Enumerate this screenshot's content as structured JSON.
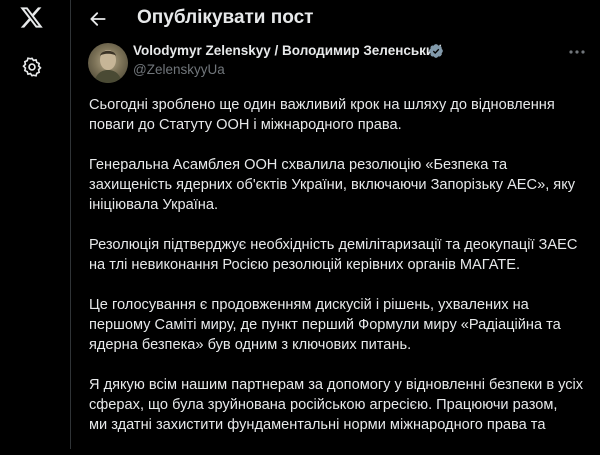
{
  "sidebar": {
    "logo_icon": "x-logo-icon",
    "settings_icon": "gear-icon"
  },
  "header": {
    "back_icon": "arrow-left-icon",
    "title": "Опублікувати пост"
  },
  "post": {
    "author_name": "Volodymyr Zelenskyy / Володимир Зеленський",
    "author_handle": "@ZelenskyyUa",
    "verified_icon": "verified-badge-icon",
    "more_icon": "more-horizontal-icon",
    "paragraphs": [
      [
        "Сьогодні зроблено ще один важливий крок на шляху до відновлення",
        "поваги до Статуту ООН і міжнародного права."
      ],
      [
        "Генеральна Асамблея ООН схвалила резолюцію «Безпека та",
        "захищеність ядерних об'єктів України, включаючи Запорізьку АЕС», яку",
        "ініціювала Україна."
      ],
      [
        "Резолюція підтверджує необхідність демілітаризації та деокупації ЗАЕС",
        "на тлі невиконання Росією резолюцій керівних органів МАГАТЕ."
      ],
      [
        "Це голосування є продовженням дискусій і рішень, ухвалених на",
        "першому Саміті миру, де пункт перший Формули миру «Радіаційна та",
        "ядерна безпека» був одним з ключових питань."
      ],
      [
        "Я дякую всім нашим партнерам за допомогу у відновленні безпеки в усіх",
        "сферах, що була зруйнована російською агресією. Працюючи разом,",
        "ми здатні захистити фундаментальні норми міжнародного права та"
      ]
    ]
  },
  "colors": {
    "background": "#000000",
    "text": "#e7e9ea",
    "secondary_text": "#71767b",
    "verified": "#829aab",
    "border": "#2f3336"
  }
}
